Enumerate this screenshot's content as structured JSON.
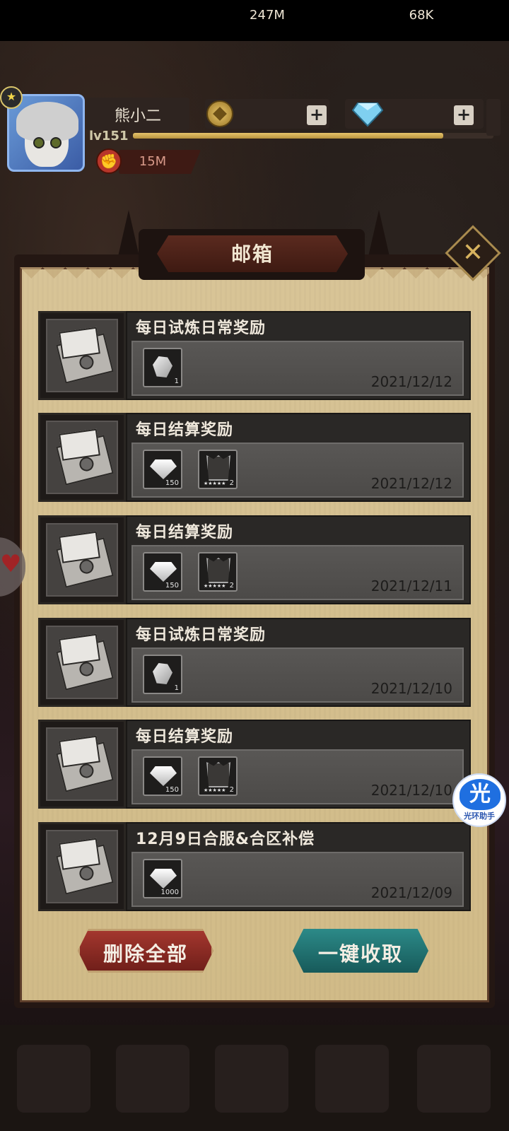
{
  "player": {
    "name": "熊小二",
    "level": "lv151",
    "power": "15M",
    "xp_fraction": 0.86
  },
  "resources": {
    "gold": "247M",
    "diamonds": "68K"
  },
  "mailbox": {
    "title": "邮箱",
    "mails": [
      {
        "title": "每日试炼日常奖励",
        "date": "2021/12/12",
        "items": [
          {
            "type": "gem",
            "count": "1"
          }
        ]
      },
      {
        "title": "每日结算奖励",
        "date": "2021/12/12",
        "items": [
          {
            "type": "diamond",
            "count": "150"
          },
          {
            "type": "armor",
            "count": "2",
            "stars": "★★★★★"
          }
        ]
      },
      {
        "title": "每日结算奖励",
        "date": "2021/12/11",
        "items": [
          {
            "type": "diamond",
            "count": "150"
          },
          {
            "type": "armor",
            "count": "2",
            "stars": "★★★★★"
          }
        ]
      },
      {
        "title": "每日试炼日常奖励",
        "date": "2021/12/10",
        "items": [
          {
            "type": "gem",
            "count": "1"
          }
        ]
      },
      {
        "title": "每日结算奖励",
        "date": "2021/12/10",
        "items": [
          {
            "type": "diamond",
            "count": "150"
          },
          {
            "type": "armor",
            "count": "2",
            "stars": "★★★★★"
          }
        ]
      },
      {
        "title": "12月9日合服&合区补偿",
        "date": "2021/12/09",
        "items": [
          {
            "type": "diamond",
            "count": "1000"
          }
        ]
      }
    ],
    "delete_all_label": "删除全部",
    "collect_all_label": "一键收取"
  },
  "overlay": {
    "helper_glyph": "光",
    "helper_label": "光环助手"
  },
  "colors": {
    "delete_button": "#8e2a26",
    "collect_button": "#1f6b6b"
  }
}
